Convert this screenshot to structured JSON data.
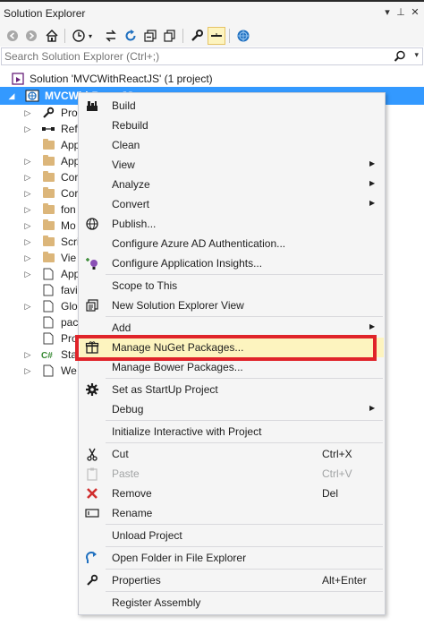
{
  "window": {
    "title": "Solution Explorer"
  },
  "titlebar_buttons": {
    "dropdown_glyph": "▾",
    "pin_glyph": "⊥",
    "close_glyph": "✕"
  },
  "toolbar": {
    "icons": [
      "back-icon",
      "forward-icon",
      "home-icon",
      "history-icon",
      "sync-icon",
      "refresh-icon",
      "collapse-all-icon",
      "copy-icon",
      "properties-icon",
      "show-all-files-icon",
      "preview-icon"
    ]
  },
  "search": {
    "placeholder": "Search Solution Explorer (Ctrl+;)"
  },
  "tree": {
    "solution": "Solution 'MVCWithReactJS' (1 project)",
    "project": "MVCWithReactJS",
    "items": [
      {
        "label": "Pro",
        "icon": "wrench-icon",
        "expander": true
      },
      {
        "label": "Ref",
        "icon": "references-icon",
        "expander": true
      },
      {
        "label": "App",
        "icon": "folder-icon",
        "expander": false
      },
      {
        "label": "App",
        "icon": "folder-icon",
        "expander": true
      },
      {
        "label": "Cor",
        "icon": "folder-icon",
        "expander": true
      },
      {
        "label": "Cor",
        "icon": "folder-icon",
        "expander": true
      },
      {
        "label": "fon",
        "icon": "folder-icon",
        "expander": true
      },
      {
        "label": "Mo",
        "icon": "folder-icon",
        "expander": true
      },
      {
        "label": "Scri",
        "icon": "folder-icon",
        "expander": true
      },
      {
        "label": "Vie",
        "icon": "folder-icon",
        "expander": true
      },
      {
        "label": "App",
        "icon": "file-icon",
        "expander": true
      },
      {
        "label": "favi",
        "icon": "file-icon",
        "expander": false
      },
      {
        "label": "Glo",
        "icon": "file-icon",
        "expander": true
      },
      {
        "label": "pac",
        "icon": "file-icon",
        "expander": false
      },
      {
        "label": "Pro",
        "icon": "file-icon",
        "expander": false
      },
      {
        "label": "Sta",
        "icon": "csharp-icon",
        "expander": true
      },
      {
        "label": "We",
        "icon": "file-icon",
        "expander": true
      }
    ]
  },
  "context_menu": {
    "groups": [
      [
        {
          "label": "Build",
          "icon": "build-icon"
        },
        {
          "label": "Rebuild"
        },
        {
          "label": "Clean"
        },
        {
          "label": "View",
          "submenu": true
        },
        {
          "label": "Analyze",
          "submenu": true
        },
        {
          "label": "Convert",
          "submenu": true
        },
        {
          "label": "Publish...",
          "icon": "globe-icon"
        },
        {
          "label": "Configure Azure AD Authentication..."
        },
        {
          "label": "Configure Application Insights...",
          "icon": "insights-icon"
        }
      ],
      [
        {
          "label": "Scope to This"
        },
        {
          "label": "New Solution Explorer View",
          "icon": "new-view-icon"
        }
      ],
      [
        {
          "label": "Add",
          "submenu": true
        },
        {
          "label": "Manage NuGet Packages...",
          "icon": "nuget-icon",
          "highlight": true
        },
        {
          "label": "Manage Bower Packages..."
        }
      ],
      [
        {
          "label": "Set as StartUp Project",
          "icon": "gear-icon"
        },
        {
          "label": "Debug",
          "submenu": true
        }
      ],
      [
        {
          "label": "Initialize Interactive with Project"
        }
      ],
      [
        {
          "label": "Cut",
          "icon": "scissors-icon",
          "shortcut": "Ctrl+X"
        },
        {
          "label": "Paste",
          "icon": "paste-icon",
          "shortcut": "Ctrl+V",
          "disabled": true
        },
        {
          "label": "Remove",
          "icon": "remove-x-icon",
          "shortcut": "Del"
        },
        {
          "label": "Rename",
          "icon": "rename-icon"
        }
      ],
      [
        {
          "label": "Unload Project"
        }
      ],
      [
        {
          "label": "Open Folder in File Explorer",
          "icon": "open-folder-icon"
        }
      ],
      [
        {
          "label": "Properties",
          "icon": "wrench-icon",
          "shortcut": "Alt+Enter"
        }
      ],
      [
        {
          "label": "Register Assembly"
        }
      ]
    ]
  },
  "colors": {
    "selection": "#3399ff",
    "menu_background": "#f5f5f5",
    "highlight_background": "#fdf4bf",
    "annotation_box": "#e0242a",
    "folder": "#dcb67a"
  }
}
